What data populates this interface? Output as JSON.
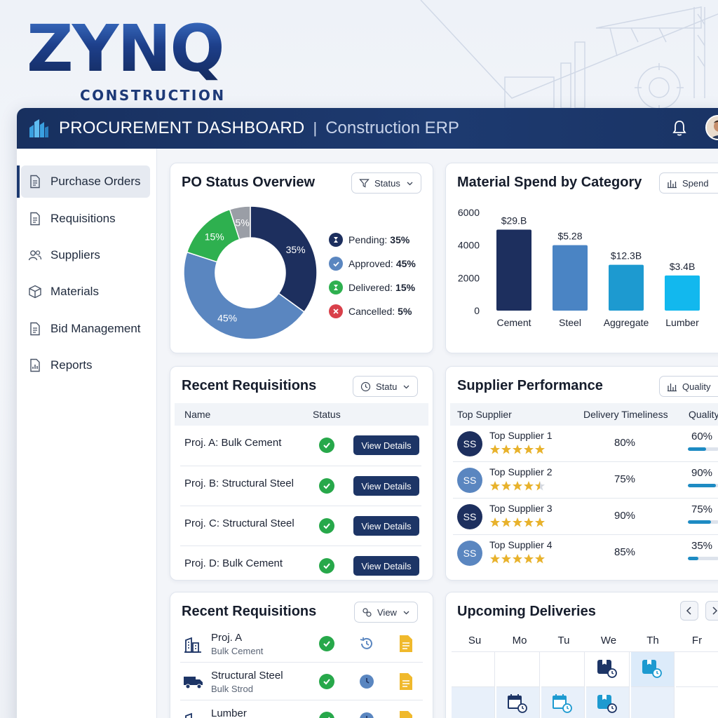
{
  "brand": {
    "name": "ZYNQ",
    "tagline": "CONSTRUCTION"
  },
  "header": {
    "title": "PROCUREMENT DASHBOARD",
    "separator": "|",
    "subtitle": "Construction ERP",
    "icons": [
      "buildings-icon",
      "bell-icon",
      "user-avatar"
    ]
  },
  "sidebar": {
    "items": [
      {
        "label": "Purchase Orders",
        "icon": "document-icon",
        "active": true
      },
      {
        "label": "Requisitions",
        "icon": "document-icon",
        "active": false
      },
      {
        "label": "Suppliers",
        "icon": "users-icon",
        "active": false
      },
      {
        "label": "Materials",
        "icon": "cube-icon",
        "active": false
      },
      {
        "label": "Bid Management",
        "icon": "document-icon",
        "active": false
      },
      {
        "label": "Reports",
        "icon": "report-icon",
        "active": false
      }
    ]
  },
  "po_status": {
    "title": "PO Status Overview",
    "filter_label": "Status",
    "slice_labels": [
      "35%",
      "45%",
      "15%",
      "5%"
    ],
    "legend": [
      {
        "name": "Pending:",
        "value": "35%",
        "color": "#1d2f5e",
        "icon": "hourglass-icon"
      },
      {
        "name": "Approved:",
        "value": "45%",
        "color": "#5a86c0",
        "icon": "check-icon"
      },
      {
        "name": "Delivered:",
        "value": "15%",
        "color": "#2eb04f",
        "icon": "hourglass-icon"
      },
      {
        "name": "Cancelled:",
        "value": "5%",
        "color": "#d9404a",
        "icon": "x-icon"
      }
    ]
  },
  "material_spend": {
    "title": "Material Spend by Category",
    "filter_label": "Spend"
  },
  "chart_data": [
    {
      "type": "pie",
      "title": "PO Status Overview",
      "categories": [
        "Pending",
        "Approved",
        "Delivered",
        "Cancelled"
      ],
      "values": [
        35,
        45,
        15,
        5
      ],
      "colors": [
        "#1d2f5e",
        "#5a86c0",
        "#2eb04f",
        "#9a9ea6"
      ]
    },
    {
      "type": "bar",
      "title": "Material Spend by Category",
      "categories": [
        "Cement",
        "Steel",
        "Aggregate",
        "Lumber"
      ],
      "values": [
        4950,
        4000,
        2800,
        2150
      ],
      "data_labels": [
        "$29.B",
        "$5.28",
        "$12.3B",
        "$3.4B"
      ],
      "yticks": [
        "0",
        "2000",
        "4000",
        "6000"
      ],
      "ylim": [
        0,
        6000
      ],
      "colors": [
        "#1d2f5e",
        "#4a84c4",
        "#1d9ad0",
        "#12b8ee"
      ]
    }
  ],
  "recent_requisitions": {
    "title": "Recent Requisitions",
    "filter_label": "Statu",
    "columns": [
      "Name",
      "Status"
    ],
    "rows": [
      {
        "name": "Proj. A: Bulk Cement",
        "action": "View Details"
      },
      {
        "name": "Proj. B: Structural Steel",
        "action": "View Details"
      },
      {
        "name": "Proj. C: Structural Steel",
        "action": "View Details"
      },
      {
        "name": "Proj. D: Bulk Cement",
        "action": "View Details"
      }
    ]
  },
  "supplier_performance": {
    "title": "Supplier Performance",
    "filter_label": "Quality",
    "columns": [
      "Top Supplier",
      "Delivery Timeliness",
      "Quality"
    ],
    "rows": [
      {
        "initials": "SS",
        "name": "Top Supplier 1",
        "stars": 5,
        "timeliness": "80%",
        "quality": "60%",
        "quality_value": 0.6,
        "avatar_color": "#1d2f5e"
      },
      {
        "initials": "SS",
        "name": "Top Supplier 2",
        "stars": 4.5,
        "timeliness": "75%",
        "quality": "90%",
        "quality_value": 0.9,
        "avatar_color": "#5a86c0"
      },
      {
        "initials": "SS",
        "name": "Top Supplier 3",
        "stars": 5,
        "timeliness": "90%",
        "quality": "75%",
        "quality_value": 0.75,
        "avatar_color": "#1d2f5e"
      },
      {
        "initials": "SS",
        "name": "Top Supplier 4",
        "stars": 5,
        "timeliness": "85%",
        "quality": "35%",
        "quality_value": 0.35,
        "avatar_color": "#5a86c0"
      }
    ]
  },
  "recent_requisitions_2": {
    "title": "Recent Requisitions",
    "filter_label": "View",
    "rows": [
      {
        "name": "Proj. A",
        "sub": "Bulk Cement",
        "icon": "building-icon"
      },
      {
        "name": "Structural Steel",
        "sub": "Bulk Strod",
        "icon": "truck-icon"
      },
      {
        "name": "Lumber",
        "sub": "",
        "icon": "building-icon"
      }
    ]
  },
  "upcoming_deliveries": {
    "title": "Upcoming Deliveries",
    "days": [
      "Su",
      "Mo",
      "Tu",
      "We",
      "Th",
      "Fr"
    ]
  }
}
